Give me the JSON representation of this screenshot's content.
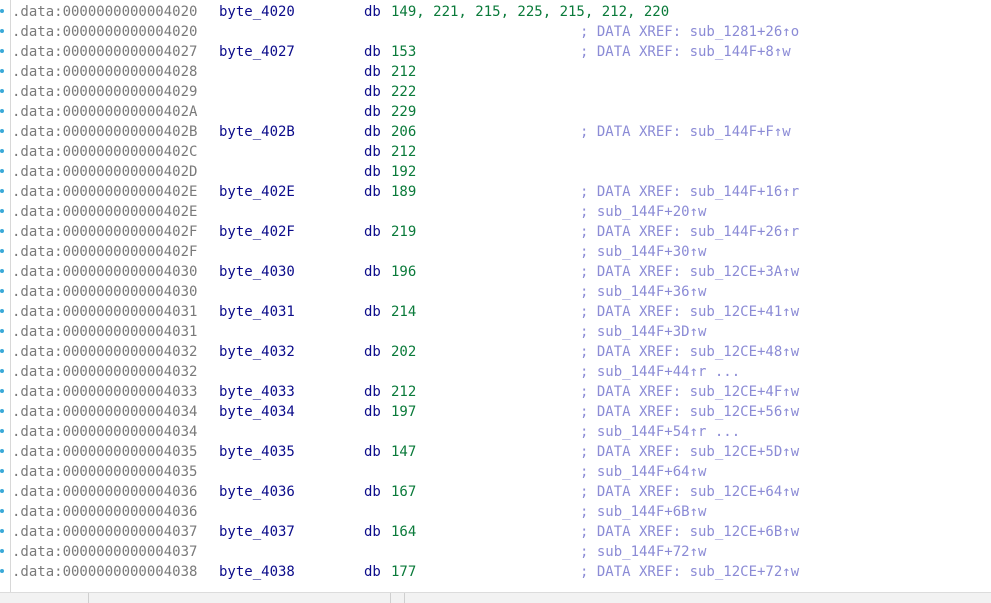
{
  "colors": {
    "address": "#7a7a7a",
    "label": "#0b0b8a",
    "mnemonic": "#0b0b8a",
    "value": "#0a7a3a",
    "comment": "#8b8bd6",
    "marker": "#3aa9d8"
  },
  "rows": [
    {
      "addr": ".data:0000000000004020",
      "label": "byte_4020",
      "db": "db",
      "val": "149, 221, 215, 225, 215, 212, 220",
      "cmt": "",
      "marker": true
    },
    {
      "addr": ".data:0000000000004020",
      "label": "",
      "db": "",
      "val": "",
      "cmt": "; DATA XREF: sub_1281+26↑o",
      "marker": true
    },
    {
      "addr": ".data:0000000000004027",
      "label": "byte_4027",
      "db": "db",
      "val": "153",
      "cmt": "; DATA XREF: sub_144F+8↑w",
      "marker": true
    },
    {
      "addr": ".data:0000000000004028",
      "label": "",
      "db": "db",
      "val": "212",
      "cmt": "",
      "marker": true
    },
    {
      "addr": ".data:0000000000004029",
      "label": "",
      "db": "db",
      "val": "222",
      "cmt": "",
      "marker": true
    },
    {
      "addr": ".data:000000000000402A",
      "label": "",
      "db": "db",
      "val": "229",
      "cmt": "",
      "marker": true
    },
    {
      "addr": ".data:000000000000402B",
      "label": "byte_402B",
      "db": "db",
      "val": "206",
      "cmt": "; DATA XREF: sub_144F+F↑w",
      "marker": true
    },
    {
      "addr": ".data:000000000000402C",
      "label": "",
      "db": "db",
      "val": "212",
      "cmt": "",
      "marker": true
    },
    {
      "addr": ".data:000000000000402D",
      "label": "",
      "db": "db",
      "val": "192",
      "cmt": "",
      "marker": true
    },
    {
      "addr": ".data:000000000000402E",
      "label": "byte_402E",
      "db": "db",
      "val": "189",
      "cmt": "; DATA XREF: sub_144F+16↑r",
      "marker": true
    },
    {
      "addr": ".data:000000000000402E",
      "label": "",
      "db": "",
      "val": "",
      "cmt": "; sub_144F+20↑w",
      "marker": true
    },
    {
      "addr": ".data:000000000000402F",
      "label": "byte_402F",
      "db": "db",
      "val": "219",
      "cmt": "; DATA XREF: sub_144F+26↑r",
      "marker": true
    },
    {
      "addr": ".data:000000000000402F",
      "label": "",
      "db": "",
      "val": "",
      "cmt": "; sub_144F+30↑w",
      "marker": true
    },
    {
      "addr": ".data:0000000000004030",
      "label": "byte_4030",
      "db": "db",
      "val": "196",
      "cmt": "; DATA XREF: sub_12CE+3A↑w",
      "marker": true
    },
    {
      "addr": ".data:0000000000004030",
      "label": "",
      "db": "",
      "val": "",
      "cmt": "; sub_144F+36↑w",
      "marker": true
    },
    {
      "addr": ".data:0000000000004031",
      "label": "byte_4031",
      "db": "db",
      "val": "214",
      "cmt": "; DATA XREF: sub_12CE+41↑w",
      "marker": true
    },
    {
      "addr": ".data:0000000000004031",
      "label": "",
      "db": "",
      "val": "",
      "cmt": "; sub_144F+3D↑w",
      "marker": true
    },
    {
      "addr": ".data:0000000000004032",
      "label": "byte_4032",
      "db": "db",
      "val": "202",
      "cmt": "; DATA XREF: sub_12CE+48↑w",
      "marker": true
    },
    {
      "addr": ".data:0000000000004032",
      "label": "",
      "db": "",
      "val": "",
      "cmt": "; sub_144F+44↑r ...",
      "marker": true
    },
    {
      "addr": ".data:0000000000004033",
      "label": "byte_4033",
      "db": "db",
      "val": "212",
      "cmt": "; DATA XREF: sub_12CE+4F↑w",
      "marker": true
    },
    {
      "addr": ".data:0000000000004034",
      "label": "byte_4034",
      "db": "db",
      "val": "197",
      "cmt": "; DATA XREF: sub_12CE+56↑w",
      "marker": true
    },
    {
      "addr": ".data:0000000000004034",
      "label": "",
      "db": "",
      "val": "",
      "cmt": "; sub_144F+54↑r ...",
      "marker": true
    },
    {
      "addr": ".data:0000000000004035",
      "label": "byte_4035",
      "db": "db",
      "val": "147",
      "cmt": "; DATA XREF: sub_12CE+5D↑w",
      "marker": true
    },
    {
      "addr": ".data:0000000000004035",
      "label": "",
      "db": "",
      "val": "",
      "cmt": "; sub_144F+64↑w",
      "marker": true
    },
    {
      "addr": ".data:0000000000004036",
      "label": "byte_4036",
      "db": "db",
      "val": "167",
      "cmt": "; DATA XREF: sub_12CE+64↑w",
      "marker": true
    },
    {
      "addr": ".data:0000000000004036",
      "label": "",
      "db": "",
      "val": "",
      "cmt": "; sub_144F+6B↑w",
      "marker": true
    },
    {
      "addr": ".data:0000000000004037",
      "label": "byte_4037",
      "db": "db",
      "val": "164",
      "cmt": "; DATA XREF: sub_12CE+6B↑w",
      "marker": true
    },
    {
      "addr": ".data:0000000000004037",
      "label": "",
      "db": "",
      "val": "",
      "cmt": "; sub_144F+72↑w",
      "marker": true
    },
    {
      "addr": ".data:0000000000004038",
      "label": "byte_4038",
      "db": "db",
      "val": "177",
      "cmt": "; DATA XREF: sub_12CE+72↑w",
      "marker": true
    }
  ]
}
